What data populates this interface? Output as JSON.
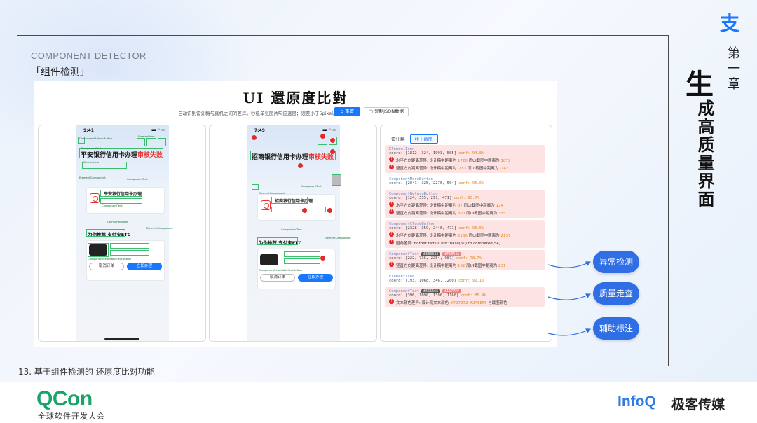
{
  "slide": {
    "section_en": "COMPONENT DETECTOR",
    "section_cn": "「组件检测」",
    "caption": "13. 基于组件检测的 还原度比对功能",
    "chapter_num": "第一章",
    "chapter_big": "生",
    "chapter_title": "成高质量界面",
    "logo_alipay": "支",
    "qcon": "QCon",
    "qcon_sub": "全球软件开发大会",
    "infoq": "InfoQ",
    "geek": "极客传媒",
    "bubbles": [
      "异常检测",
      "质量走查",
      "辅助标注"
    ],
    "accent": "#2f6ee5"
  },
  "tool": {
    "title": "UI 還原度比對",
    "desc": "自动识别设计稿与真机之间的差异。秒级单张图片响应速度；误差小于5pixel。",
    "reset_label": "⌂ 重置",
    "json_label": "▢ 复制JSON数据",
    "design_phone": {
      "time": "9:41",
      "status": "▪▪ ◠ ▭",
      "bank": "平安银行信用卡办理",
      "bank_fail": "审核失败",
      "card_line1": "平安银行信用卡办理",
      "etc_title": "为你推荐 支付宝ETC",
      "btn_cancel": "取消订单",
      "btn_go": "立即办理"
    },
    "real_phone": {
      "time": "7:49",
      "status": "▪▪ ◠ ▭",
      "bank": "招商银行信用卡办理",
      "bank_fail": "审核失败",
      "card_line1": "招商银行信用卡办理",
      "etc_title": "为你推荐 支付宝ETC",
      "btn_cancel": "取消订单",
      "btn_go": "立即办理"
    },
    "labels": {
      "return": "ComponentReturnButton",
      "icon": "ElementIcon",
      "text": "ComponentText",
      "comp": "ElementComponent",
      "more": "ComponentMoreButton",
      "sel": "ComponentSelectableTextButton"
    },
    "tabs": [
      "设计稿",
      "线上截图"
    ],
    "results": [
      {
        "name": "ElementIcon",
        "coord": "coord: [1812, 324, 1993, 505]",
        "conf": "conf: 94.8%",
        "err": true,
        "lines": [
          [
            "水平方向距离差异: 设计稿中距离为 ",
            "1726",
            " 而UI截图中距离为 ",
            "1872"
          ],
          [
            "竖直方向距离差异: 设计稿中距离为 ",
            "-153",
            " 而UI截图中距离为 ",
            "-147"
          ]
        ]
      },
      {
        "name": "ComponentMoreButton",
        "coord": "coord: [2041, 325, 2276, 504]",
        "conf": "conf: 95.6%",
        "err": false,
        "lines": []
      },
      {
        "name": "ComponentReturnButton",
        "coord": "coord: [124, 355, 291, 471]",
        "conf": "conf: 95.7%",
        "err": true,
        "lines": [
          [
            "水平方向距离差异: 设计稿中距离为 ",
            "87",
            " 而UI截图中距离为 ",
            "124"
          ],
          [
            "竖直方向距离差异: 设计稿中距离为 ",
            "300",
            " 而UI截图中距离为 ",
            "355"
          ]
        ]
      },
      {
        "name": "ComponentCloseButton",
        "coord": "coord: [2328, 359, 2446, 471]",
        "conf": "conf: 90.5%",
        "err": true,
        "lines": [
          [
            "水平方向距离差异: 设计稿中距离为 ",
            "2160",
            " 而UI截图中距离为 ",
            "2137"
          ],
          [
            "圆角差异: border radius diff: base(60) to compared(54)",
            "",
            "",
            ""
          ]
        ]
      },
      {
        "name": "ComponentText",
        "coord": "coord: [222, 736, 2254, 987]",
        "conf": "conf: 78.7%",
        "err": true,
        "chips": [
          "#333333",
          "#F53A4A"
        ],
        "lines": [
          [
            "竖直方向距离差异: 设计稿中距离为 ",
            "162",
            " 而UI截图中距离为 ",
            "231"
          ]
        ]
      },
      {
        "name": "ElementIcon",
        "coord": "coord: [193, 1068, 346, 1200]",
        "conf": "conf: 91.1%",
        "err": false,
        "lines": []
      },
      {
        "name": "ComponentText",
        "coord": "coord: [396, 1090, 1396, 1168]",
        "conf": "conf: 85.4%",
        "err": true,
        "chips": [
          "#666666",
          "#1677FF"
        ],
        "lines": [
          [
            "文本颜色差异: 设计稿文本颜色 ",
            "#727272 #2A8EFF",
            " 与截图颜色",
            ""
          ]
        ]
      }
    ]
  }
}
